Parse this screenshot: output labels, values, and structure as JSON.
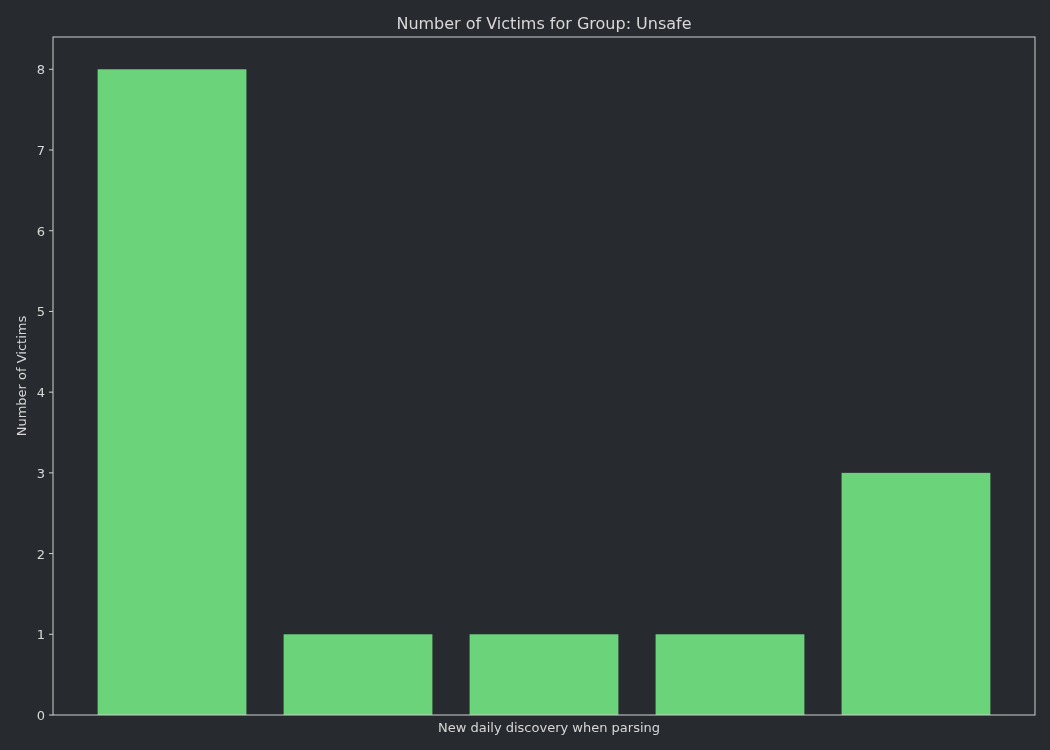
{
  "chart": {
    "chart_data": {
      "type": "bar",
      "title": "Number of Victims for Group: Unsafe",
      "xlabel": "New daily discovery when parsing",
      "ylabel": "Number of Victims",
      "series": [
        {
          "color": "#6bd47b",
          "values": [
            8,
            1,
            1,
            1,
            3
          ]
        }
      ],
      "ylim": [
        0,
        8.4
      ],
      "yticks": [
        0,
        1,
        2,
        3,
        4,
        5,
        6,
        7,
        8
      ]
    }
  }
}
